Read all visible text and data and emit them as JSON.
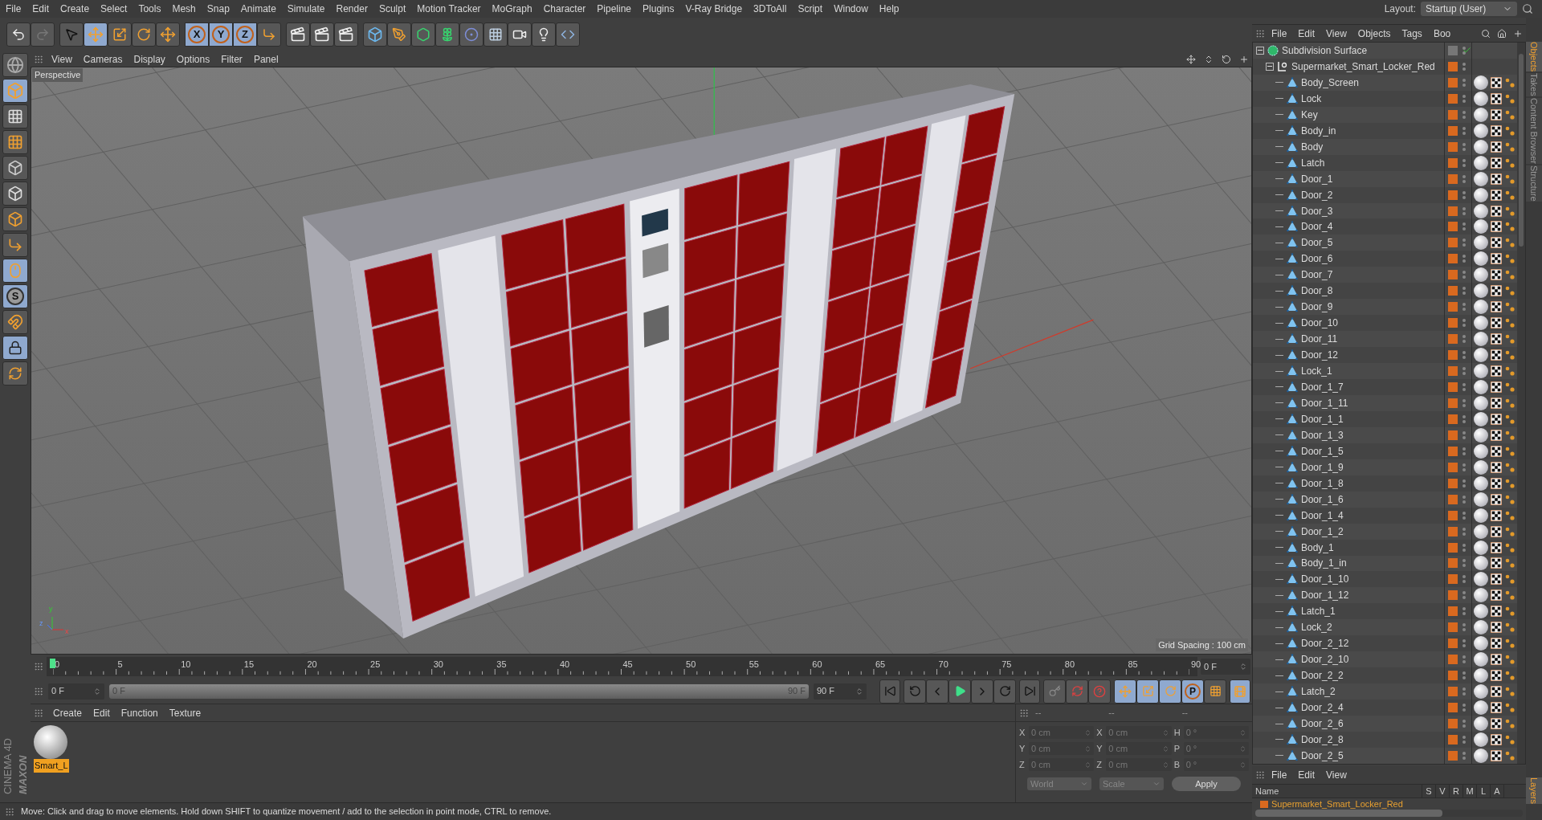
{
  "menu_bar": [
    "File",
    "Edit",
    "Create",
    "Select",
    "Tools",
    "Mesh",
    "Snap",
    "Animate",
    "Simulate",
    "Render",
    "Sculpt",
    "Motion Tracker",
    "MoGraph",
    "Character",
    "Pipeline",
    "Plugins",
    "V-Ray Bridge",
    "3DToAll",
    "Script",
    "Window",
    "Help"
  ],
  "layout": {
    "label": "Layout:",
    "value": "Startup (User)"
  },
  "tools": [
    {
      "selected": false
    },
    {
      "selected": true
    },
    {
      "selected": false
    },
    {
      "selected": false
    },
    {
      "selected": false
    }
  ],
  "axis_lock": [
    {
      "label": "X",
      "selected": true
    },
    {
      "label": "Y",
      "selected": true
    },
    {
      "label": "Z",
      "selected": true
    }
  ],
  "mode_tools": [
    {
      "selected": false
    },
    {
      "selected": true
    },
    {
      "selected": false
    },
    {
      "selected": false
    },
    {
      "selected": false
    },
    {
      "selected": false
    },
    {
      "selected": false
    },
    {
      "selected": false
    },
    {
      "selected": true
    },
    {
      "label": "S",
      "selected": true
    },
    {
      "selected": false
    },
    {
      "selected": true
    },
    {
      "selected": false
    }
  ],
  "viewport": {
    "menu": [
      "View",
      "Cameras",
      "Display",
      "Options",
      "Filter",
      "Panel"
    ],
    "camera": "Perspective",
    "grid_spacing": "Grid Spacing : 100 cm",
    "gizmo_labels": [
      "y",
      "z",
      "x"
    ]
  },
  "timeline": {
    "ticks": [
      "0",
      "5",
      "10",
      "15",
      "20",
      "25",
      "30",
      "35",
      "40",
      "45",
      "50",
      "55",
      "60",
      "65",
      "70",
      "75",
      "80",
      "85",
      "90"
    ],
    "playhead": {
      "level": 0
    },
    "current": "0 F"
  },
  "frame_range": {
    "level": 1,
    "start_field": "0 F",
    "slider_start": "0 F",
    "slider_end": "90 F",
    "end_field": "90 F"
  },
  "key_tools": [
    {
      "selected": true
    },
    {
      "selected": true
    },
    {
      "selected": true
    },
    {
      "label": "P",
      "selected": true
    },
    {
      "selected": false
    }
  ],
  "materials": {
    "menu": [
      "Create",
      "Edit",
      "Function",
      "Texture"
    ],
    "items": [
      {
        "name": "Smart_L",
        "selected": true
      }
    ]
  },
  "coordinates": {
    "headers": [
      "--",
      "--",
      "--"
    ],
    "rows": [
      {
        "axis": "X",
        "position": "0 cm",
        "size_axis": "X",
        "size": "0 cm",
        "rot_axis": "H",
        "rotation": "0 °"
      },
      {
        "axis": "Y",
        "position": "0 cm",
        "size_axis": "Y",
        "size": "0 cm",
        "rot_axis": "P",
        "rotation": "0 °"
      },
      {
        "axis": "Z",
        "position": "0 cm",
        "size_axis": "Z",
        "size": "0 cm",
        "rot_axis": "B",
        "rotation": "0 °"
      }
    ],
    "space": "World",
    "size_mode": "Scale",
    "apply": "Apply"
  },
  "logo": [
    "MAXON",
    "CINEMA 4D"
  ],
  "status_bar": "Move: Click and drag to move elements. Hold down SHIFT to quantize movement / add to the selection in point mode, CTRL to remove.",
  "object_manager": {
    "menu": [
      "File",
      "Edit",
      "View",
      "Objects",
      "Tags",
      "Boo"
    ],
    "objects": [
      {
        "name": "Subdivision Surface",
        "kind": "subdivision",
        "expanded": true,
        "children": [
          {
            "name": "Supermarket_Smart_Locker_Red",
            "kind": "null",
            "expanded": true,
            "children": [
              {
                "name": "Body_Screen",
                "kind": "polygon"
              },
              {
                "name": "Lock",
                "kind": "polygon"
              },
              {
                "name": "Key",
                "kind": "polygon"
              },
              {
                "name": "Body_in",
                "kind": "polygon"
              },
              {
                "name": "Body",
                "kind": "polygon"
              },
              {
                "name": "Latch",
                "kind": "polygon"
              },
              {
                "name": "Door_1",
                "kind": "polygon"
              },
              {
                "name": "Door_2",
                "kind": "polygon"
              },
              {
                "name": "Door_3",
                "kind": "polygon"
              },
              {
                "name": "Door_4",
                "kind": "polygon"
              },
              {
                "name": "Door_5",
                "kind": "polygon"
              },
              {
                "name": "Door_6",
                "kind": "polygon"
              },
              {
                "name": "Door_7",
                "kind": "polygon"
              },
              {
                "name": "Door_8",
                "kind": "polygon"
              },
              {
                "name": "Door_9",
                "kind": "polygon"
              },
              {
                "name": "Door_10",
                "kind": "polygon"
              },
              {
                "name": "Door_11",
                "kind": "polygon"
              },
              {
                "name": "Door_12",
                "kind": "polygon"
              },
              {
                "name": "Lock_1",
                "kind": "polygon"
              },
              {
                "name": "Door_1_7",
                "kind": "polygon"
              },
              {
                "name": "Door_1_11",
                "kind": "polygon"
              },
              {
                "name": "Door_1_1",
                "kind": "polygon"
              },
              {
                "name": "Door_1_3",
                "kind": "polygon"
              },
              {
                "name": "Door_1_5",
                "kind": "polygon"
              },
              {
                "name": "Door_1_9",
                "kind": "polygon"
              },
              {
                "name": "Door_1_8",
                "kind": "polygon"
              },
              {
                "name": "Door_1_6",
                "kind": "polygon"
              },
              {
                "name": "Door_1_4",
                "kind": "polygon"
              },
              {
                "name": "Door_1_2",
                "kind": "polygon"
              },
              {
                "name": "Body_1",
                "kind": "polygon"
              },
              {
                "name": "Body_1_in",
                "kind": "polygon"
              },
              {
                "name": "Door_1_10",
                "kind": "polygon"
              },
              {
                "name": "Door_1_12",
                "kind": "polygon"
              },
              {
                "name": "Latch_1",
                "kind": "polygon"
              },
              {
                "name": "Lock_2",
                "kind": "polygon"
              },
              {
                "name": "Door_2_12",
                "kind": "polygon"
              },
              {
                "name": "Door_2_10",
                "kind": "polygon"
              },
              {
                "name": "Door_2_2",
                "kind": "polygon"
              },
              {
                "name": "Latch_2",
                "kind": "polygon"
              },
              {
                "name": "Door_2_4",
                "kind": "polygon"
              },
              {
                "name": "Door_2_6",
                "kind": "polygon"
              },
              {
                "name": "Door_2_8",
                "kind": "polygon"
              },
              {
                "name": "Door_2_5",
                "kind": "polygon"
              }
            ]
          }
        ]
      }
    ]
  },
  "side_tabs": [
    {
      "label": "Objects",
      "selected": true
    },
    {
      "label": "Takes",
      "selected": false
    },
    {
      "label": "Content Browser",
      "selected": false
    },
    {
      "label": "Structure",
      "selected": false
    }
  ],
  "layer_manager": {
    "menu": [
      "File",
      "Edit",
      "View"
    ],
    "columns": [
      "Name",
      "S",
      "V",
      "R",
      "M",
      "L",
      "A"
    ],
    "rows": [
      {
        "name": "Supermarket_Smart_Locker_Red"
      }
    ],
    "tab": {
      "label": "Layers",
      "selected": true
    }
  }
}
